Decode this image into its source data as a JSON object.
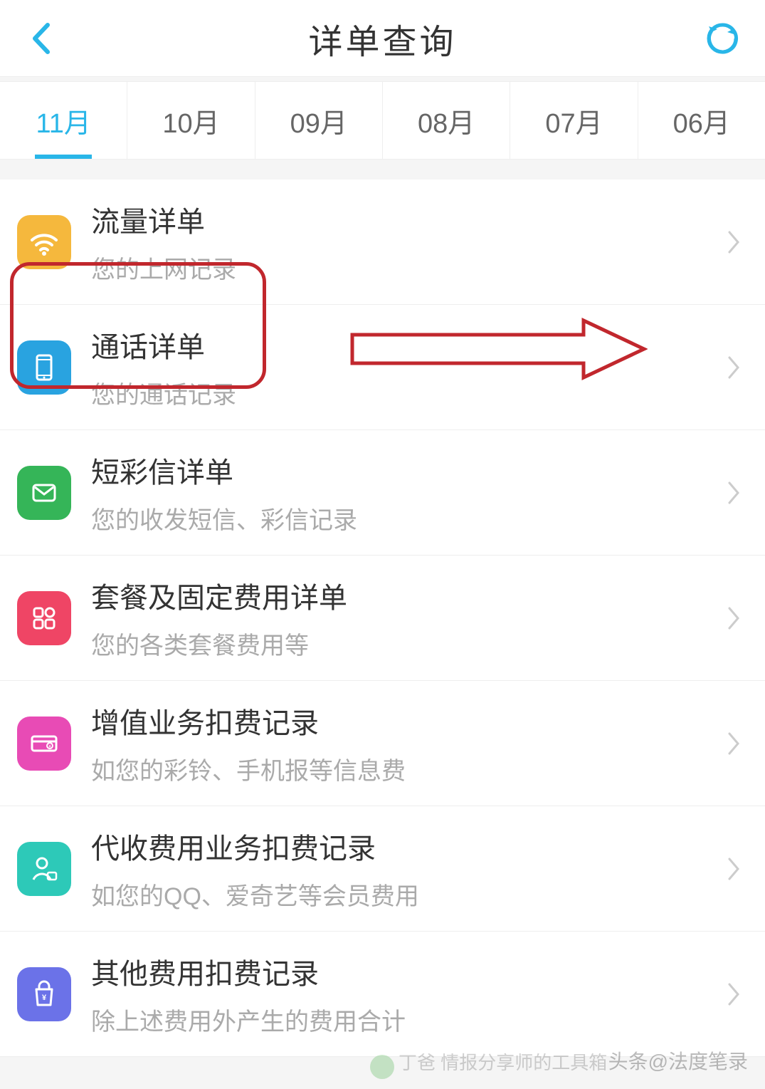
{
  "header": {
    "title": "详单查询"
  },
  "tabs": [
    {
      "label": "11月",
      "active": true
    },
    {
      "label": "10月",
      "active": false
    },
    {
      "label": "09月",
      "active": false
    },
    {
      "label": "08月",
      "active": false
    },
    {
      "label": "07月",
      "active": false
    },
    {
      "label": "06月",
      "active": false
    }
  ],
  "items": [
    {
      "title": "流量详单",
      "subtitle": "您的上网记录",
      "icon": "wifi",
      "color": "#f5b83d"
    },
    {
      "title": "通话详单",
      "subtitle": "您的通话记录",
      "icon": "phone",
      "color": "#29a3e0"
    },
    {
      "title": "短彩信详单",
      "subtitle": "您的收发短信、彩信记录",
      "icon": "mail",
      "color": "#35b558"
    },
    {
      "title": "套餐及固定费用详单",
      "subtitle": "您的各类套餐费用等",
      "icon": "grid",
      "color": "#ef4565"
    },
    {
      "title": "增值业务扣费记录",
      "subtitle": "如您的彩铃、手机报等信息费",
      "icon": "card",
      "color": "#e84bb5"
    },
    {
      "title": "代收费用业务扣费记录",
      "subtitle": "如您的QQ、爱奇艺等会员费用",
      "icon": "user",
      "color": "#2dc9b8"
    },
    {
      "title": "其他费用扣费记录",
      "subtitle": "除上述费用外产生的费用合计",
      "icon": "bag",
      "color": "#6b72e8"
    }
  ],
  "watermark": {
    "text1": "丁爸 情报分享师的工具箱",
    "text2": "头条@法度笔录"
  }
}
